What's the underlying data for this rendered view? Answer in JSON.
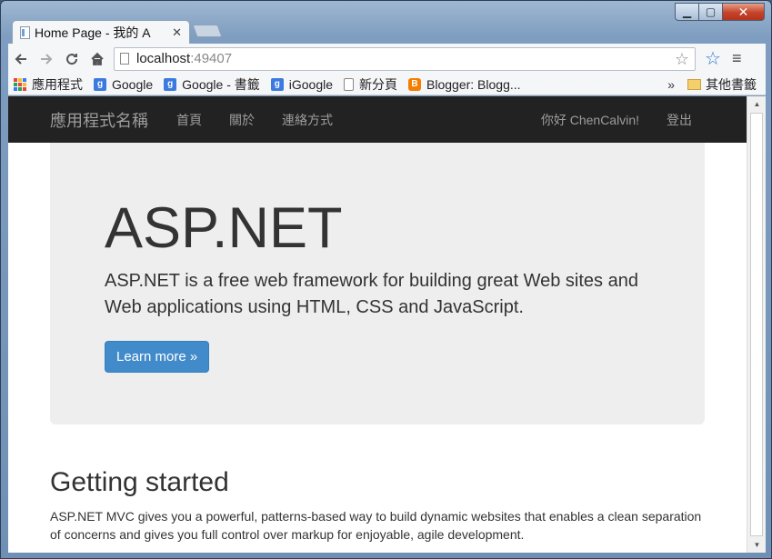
{
  "browser": {
    "tab_title": "Home Page - 我的 A",
    "url_host": "localhost",
    "url_port": ":49407"
  },
  "bookmarks": [
    {
      "label": "應用程式",
      "icon": "apps-icon"
    },
    {
      "label": "Google",
      "icon": "google-icon"
    },
    {
      "label": "Google - 書籤",
      "icon": "google-icon"
    },
    {
      "label": "iGoogle",
      "icon": "google-icon"
    },
    {
      "label": "新分頁",
      "icon": "page-icon"
    },
    {
      "label": "Blogger: Blogg...",
      "icon": "blogger-icon"
    }
  ],
  "bookmarks_more": "»",
  "bookmarks_other": "其他書籤",
  "navbar": {
    "brand": "應用程式名稱",
    "links": [
      "首頁",
      "關於",
      "連絡方式"
    ],
    "greeting": "你好 ChenCalvin!",
    "logout": "登出"
  },
  "jumbotron": {
    "title": "ASP.NET",
    "lead": "ASP.NET is a free web framework for building great Web sites and Web applications using HTML, CSS and JavaScript.",
    "button": "Learn more »"
  },
  "getting_started": {
    "heading": "Getting started",
    "text": "ASP.NET MVC gives you a powerful, patterns-based way to build dynamic websites that enables a clean separation of concerns and gives you full control over markup for enjoyable, agile development."
  },
  "colors": {
    "navbar_bg": "#222222",
    "jumbotron_bg": "#eeeeee",
    "button_primary": "#428bca"
  }
}
